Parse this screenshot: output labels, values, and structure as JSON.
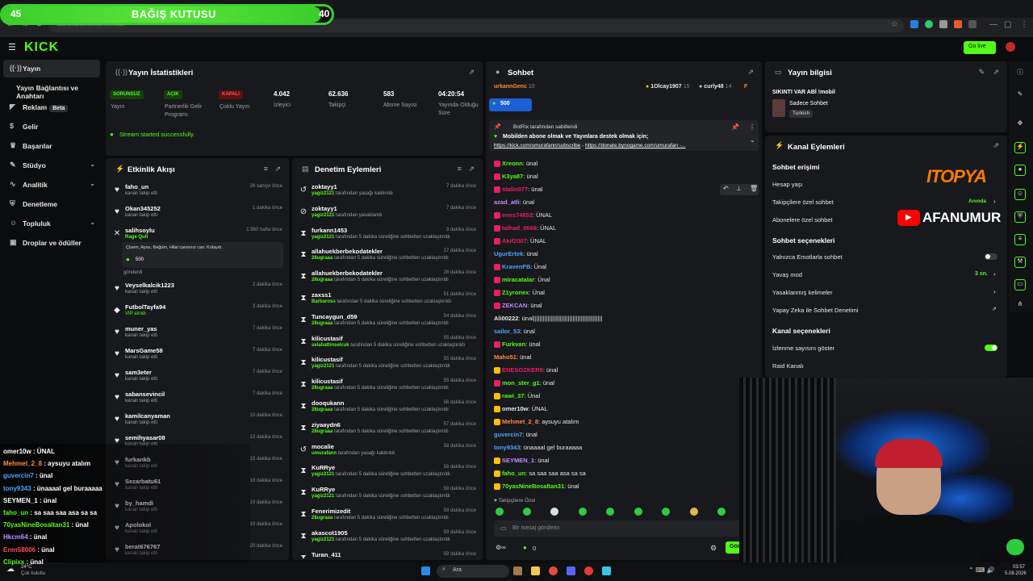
{
  "donation": {
    "title": "BAĞIŞ KUTUSU",
    "left_value": "45",
    "right_value": "40",
    "progress": 0.95
  },
  "browser": {
    "url": "dashboard.kick.com/stream"
  },
  "header": {
    "logo": "KICK",
    "go_live": "Go live"
  },
  "sidebar": {
    "items": [
      {
        "label": "Yayın",
        "icon": "broadcast-icon",
        "active": true
      },
      {
        "label": "Yayın Bağlantısı ve Anahtarı",
        "icon": "",
        "active": false
      },
      {
        "label": "Reklam",
        "badge": "Beta",
        "icon": "megaphone-icon"
      },
      {
        "label": "Gelir",
        "icon": "dollar-icon"
      },
      {
        "label": "Başarılar",
        "icon": "trophy-icon"
      },
      {
        "label": "Stüdyo",
        "icon": "brush-icon",
        "chevron": true
      },
      {
        "label": "Analitik",
        "icon": "chart-icon",
        "chevron": true
      },
      {
        "label": "Denetleme",
        "icon": "shield-icon"
      },
      {
        "label": "Topluluk",
        "icon": "users-icon",
        "chevron": true
      },
      {
        "label": "Droplar ve ödüller",
        "icon": "gift-icon"
      }
    ]
  },
  "stats": {
    "title": "Yayın İstatistikleri",
    "tags": [
      {
        "tag": "SORUNSUZ",
        "label": "Yayın",
        "color": "#53fc18"
      },
      {
        "tag": "AÇIK",
        "label": "Partnerlik Gelir Programı",
        "color": "#53fc18"
      },
      {
        "tag": "KAPALI",
        "label": "Çoklu Yayın",
        "color": "#e53935"
      }
    ],
    "values": [
      {
        "value": "4.042",
        "label": "İzleyici"
      },
      {
        "value": "62.636",
        "label": "Takipçi"
      },
      {
        "value": "583",
        "label": "Abone Sayısı"
      },
      {
        "value": "04:20:54",
        "label": "Yayında Olduğu Süre"
      }
    ],
    "status_message": "Stream started successfully."
  },
  "activity": {
    "title": "Etkinlik Akışı",
    "items": [
      {
        "name": "faho_un",
        "sub": "kanalı takip etti",
        "time": "26 saniye önce"
      },
      {
        "name": "Okan345252",
        "sub": "kanalı takip etti",
        "time": "1 dakika önce"
      },
      {
        "name": "salihsoylu",
        "sub": "Rage Quit",
        "time": "1.960 hafta önce",
        "message": "Çisem, Aysu, Beğüm, Hilal cansınız can. Kolaydı.",
        "amount": "500",
        "extra": "gönderdi"
      },
      {
        "name": "Veyselkalcik1223",
        "sub": "kanalı takip etti",
        "time": "2 dakika önce"
      },
      {
        "name": "FutbolTayfa94",
        "sub": "VIP alındı",
        "time": "3 dakika önce"
      },
      {
        "name": "muner_yas",
        "sub": "kanalı takip etti",
        "time": "7 dakika önce"
      },
      {
        "name": "MarsGame58",
        "sub": "kanalı takip etti",
        "time": "7 dakika önce"
      },
      {
        "name": "sam3eter",
        "sub": "kanalı takip etti",
        "time": "7 dakika önce"
      },
      {
        "name": "sabansevincil",
        "sub": "kanalı takip etti",
        "time": "7 dakika önce"
      },
      {
        "name": "kamilcanyaman",
        "sub": "kanalı takip etti",
        "time": "10 dakika önce"
      },
      {
        "name": "semihyasar08",
        "sub": "kanalı takip etti",
        "time": "13 dakika önce"
      },
      {
        "name": "furkankb",
        "sub": "kanalı takip etti",
        "time": "15 dakika önce"
      },
      {
        "name": "Sezarbatu61",
        "sub": "kanalı takip etti",
        "time": "18 dakika önce"
      },
      {
        "name": "by_hamdi",
        "sub": "kanalı takip etti",
        "time": "19 dakika önce"
      },
      {
        "name": "Apolokol",
        "sub": "kanalı takip etti",
        "time": "19 dakika önce"
      },
      {
        "name": "berat676767",
        "sub": "kanalı takip etti",
        "time": "20 dakika önce"
      }
    ]
  },
  "moderation": {
    "title": "Denetim Eylemleri",
    "items": [
      {
        "name": "zoktayy1",
        "mod": "yagiz2121",
        "action": "tarafından yasağı kaldırıldı",
        "time": "7 dakika önce",
        "type": "unban"
      },
      {
        "name": "zoktayy1",
        "mod": "yagiz2121",
        "action": "tarafından yasaklandı",
        "time": "7 dakika önce",
        "type": "ban"
      },
      {
        "name": "furkann1453",
        "mod": "yagiz2121",
        "action": "tarafından 5 dakika süreliğine sohbetten uzaklaştırıldı",
        "time": "9 dakika önce",
        "type": "timeout"
      },
      {
        "name": "allahuekberbekodatekler",
        "mod": "28ugraaa",
        "action": "tarafından 5 dakika süreliğine sohbetten uzaklaştırıldı",
        "time": "27 dakika önce",
        "type": "timeout"
      },
      {
        "name": "allahuekberbekodatekler",
        "mod": "28ugraaa",
        "action": "tarafından 5 dakika süreliğine sohbetten uzaklaştırıldı",
        "time": "28 dakika önce",
        "type": "timeout"
      },
      {
        "name": "zaxss1",
        "mod": "Barbaross",
        "action": "tarafından 5 dakika süreliğine sohbetten uzaklaştırıldı",
        "time": "51 dakika önce",
        "type": "timeout"
      },
      {
        "name": "Tuncaygun_d59",
        "mod": "28ugraaa",
        "action": "tarafından 5 dakika süreliğine sohbetten uzaklaştırıldı",
        "time": "54 dakika önce",
        "type": "timeout"
      },
      {
        "name": "kilicustasif",
        "mod": "selahattinselcuk",
        "action": "tarafından 5 dakika süreliğine sohbetten uzaklaştırıldı",
        "time": "55 dakika önce",
        "type": "timeout"
      },
      {
        "name": "kilicustasif",
        "mod": "yagiz2121",
        "action": "tarafından 5 dakika süreliğine sohbetten uzaklaştırıldı",
        "time": "55 dakika önce",
        "type": "timeout"
      },
      {
        "name": "kilicustasif",
        "mod": "28ugraaa",
        "action": "tarafından 5 dakika süreliğine sohbetten uzaklaştırıldı",
        "time": "55 dakika önce",
        "type": "timeout"
      },
      {
        "name": "dooqukann",
        "mod": "28ugraaa",
        "action": "tarafından 5 dakika süreliğine sohbetten uzaklaştırıldı",
        "time": "56 dakika önce",
        "type": "timeout"
      },
      {
        "name": "ziyaaydn6",
        "mod": "28ugraaa",
        "action": "tarafından 5 dakika süreliğine sohbetten uzaklaştırıldı",
        "time": "57 dakika önce",
        "type": "timeout"
      },
      {
        "name": "mocalie",
        "mod": "umurafann",
        "action": "tarafından yasağı kaldırıldı",
        "time": "58 dakika önce",
        "type": "unban"
      },
      {
        "name": "KuRRye",
        "mod": "yagiz2121",
        "action": "tarafından 5 dakika süreliğine sohbetten uzaklaştırıldı",
        "time": "58 dakika önce",
        "type": "timeout"
      },
      {
        "name": "KuRRye",
        "mod": "yagiz2121",
        "action": "tarafından 5 dakika süreliğine sohbetten uzaklaştırıldı",
        "time": "58 dakika önce",
        "type": "timeout"
      },
      {
        "name": "Fenerimizedit",
        "mod": "28ugraaa",
        "action": "tarafından 5 dakika süreliğine sohbetten uzaklaştırıldı",
        "time": "59 dakika önce",
        "type": "timeout"
      },
      {
        "name": "akascot1905",
        "mod": "yagiz2121",
        "action": "tarafından 5 dakika süreliğine sohbetten uzaklaştırıldı",
        "time": "59 dakika önce",
        "type": "timeout"
      },
      {
        "name": "Turan_411",
        "mod": "",
        "action": "",
        "time": "59 dakika önce",
        "type": "timeout"
      }
    ]
  },
  "chat": {
    "title": "Sohbet",
    "top_gifters": [
      {
        "name": "urkannGenc",
        "count": "10"
      },
      {
        "name": "1Olcay1907",
        "count": "15"
      },
      {
        "name": "curly48",
        "count": "14"
      },
      {
        "name": "F",
        "count": ""
      }
    ],
    "goal_amount": "500",
    "pinned": {
      "by": "BotRix tarafından sabitlendi",
      "text": "Mobilden abone olmak ve Yayınlara destek olmak için;",
      "link1": "https://kick.com/umurafann/subscribe",
      "sep": " - ",
      "link2": "https://donate.bynogame.com/umurafan -..."
    },
    "messages": [
      {
        "user": "Xreonn",
        "text": "ünal",
        "color": "#53fc18",
        "badge": "#e91e63"
      },
      {
        "user": "K3ya87",
        "text": "ünal",
        "color": "#53fc18",
        "badge": "#e91e63"
      },
      {
        "user": "stalin077",
        "text": "ünal",
        "color": "#e91e63",
        "badge": "#e91e63"
      },
      {
        "user": "azad_atli",
        "text": "ünal",
        "color": "#c08bff",
        "badge": ""
      },
      {
        "user": "enes74853",
        "text": "ÜNAL",
        "color": "#e91e63",
        "badge": "#e91e63"
      },
      {
        "user": "talhad_0668",
        "text": "ÜNAL",
        "color": "#e91e63",
        "badge": "#e91e63"
      },
      {
        "user": "Akif2007",
        "text": "ÜNAL",
        "color": "#e91e63",
        "badge": "#e91e63"
      },
      {
        "user": "UgurErtek",
        "text": "ünal",
        "color": "#4ea3ff",
        "badge": ""
      },
      {
        "user": "KravenFB",
        "text": "Ünal",
        "color": "#4ea3ff",
        "badge": "#e91e63"
      },
      {
        "user": "miracatalar",
        "text": "Ünal",
        "color": "#53fc18",
        "badge": "#e91e63"
      },
      {
        "user": "Z1yronex",
        "text": "Ünal",
        "color": "#53fc18",
        "badge": "#e91e63"
      },
      {
        "user": "ZEKCAN",
        "text": "ünal",
        "color": "#c08bff",
        "badge": "#e91e63"
      },
      {
        "user": "Ali00222",
        "text": "ünal||||||||||||||||||||||||||||||||||||||||||||",
        "color": "#e7e8ea",
        "badge": ""
      },
      {
        "user": "sailor_53",
        "text": "ünal",
        "color": "#4ea3ff",
        "badge": ""
      },
      {
        "user": "Furkvan",
        "text": "ünal",
        "color": "#53fc18",
        "badge": "#e91e63"
      },
      {
        "user": "Maho51",
        "text": "ünal",
        "color": "#ff8a3d",
        "badge": ""
      },
      {
        "user": "ENESOZKER9",
        "text": "ünal",
        "color": "#e91e63",
        "badge": "#ffc107"
      },
      {
        "user": "mon_ster_g1",
        "text": "ünal",
        "color": "#53fc18",
        "badge": "#e91e63"
      },
      {
        "user": "rawi_37",
        "text": "Ünal",
        "color": "#53fc18",
        "badge": "#ffc107"
      },
      {
        "user": "omer10w",
        "text": "ÜNAL",
        "color": "#e7e8ea",
        "badge": "#ffc107"
      },
      {
        "user": "Mehmet_2_8",
        "text": "aysuyu atalım",
        "color": "#ff8a3d",
        "badge": "#ffc107"
      },
      {
        "user": "guvercin7",
        "text": "ünal",
        "color": "#4ea3ff",
        "badge": ""
      },
      {
        "user": "tony9343",
        "text": "ünaaaal gel buraaaaa",
        "color": "#4ea3ff",
        "badge": ""
      },
      {
        "user": "SEYMEN_1",
        "text": "ünal",
        "color": "#c08bff",
        "badge": "#ffc107"
      },
      {
        "user": "faho_un",
        "text": "sa saa saa asa sa sa",
        "color": "#53fc18",
        "badge": "#ffc107"
      },
      {
        "user": "70yasNineBosaltan31",
        "text": "ünal",
        "color": "#53fc18",
        "badge": "#ffc107"
      }
    ],
    "follower_only": "Takipçilere Özel",
    "input_placeholder": "Bir mesaj gönderin",
    "points": "0",
    "send_label": "Gönder"
  },
  "stream_info": {
    "title": "Yayın bilgisi",
    "stream_title": "SIKINTI VAR ABİ !mobil",
    "mode": "Sadece Sohbet",
    "category": "Turkish"
  },
  "channel_actions": {
    "title": "Kanal Eylemleri",
    "chat_access": "Sohbet erişimi",
    "account_age": "Hesap yaşı",
    "followers_only": "Takipçilere özel sohbet",
    "followers_only_value": "Anında",
    "subs_only": "Abonelere özel sohbet",
    "chat_options": "Sohbet seçenekleri",
    "emotes_only": "Yalnızca Emotlarla sohbet",
    "emotes_only_on": false,
    "slow_mode": "Yavaş mod",
    "slow_mode_value": "3 sn.",
    "banned_words": "Yasaklanmış kelimeler",
    "ai_moderation": "Yapay Zeka ile Sohbet Denetimi",
    "channel_options": "Kanal seçenekleri",
    "show_viewers": "İzlenme sayısını göster",
    "show_viewers_on": true,
    "raid": "Raid Kanalı"
  },
  "overlay": {
    "brand1": "ITOPYA",
    "brand2": "AFANUMUR"
  },
  "overlay_chat": [
    {
      "user": "omer10w",
      "text": "ÜNAL",
      "color": "#ffffff"
    },
    {
      "user": "Mehmet_2_8",
      "text": "aysuyu atalım",
      "color": "#ff8a3d"
    },
    {
      "user": "guvercin7",
      "text": "ünal",
      "color": "#4ea3ff"
    },
    {
      "user": "tony9343",
      "text": "ünaaaal gel buraaaaa",
      "color": "#4ea3ff"
    },
    {
      "user": "SEYMEN_1",
      "text": "ünal",
      "color": "#ffffff"
    },
    {
      "user": "faho_un",
      "text": "sa saa saa asa sa sa",
      "color": "#53fc18"
    },
    {
      "user": "70yasNineBosaltan31",
      "text": "ünal",
      "color": "#53fc18"
    },
    {
      "user": "Hkcm64",
      "text": "ünal",
      "color": "#c08bff"
    },
    {
      "user": "Eren58006",
      "text": "ünal",
      "color": "#ff4d4d"
    },
    {
      "user": "Clipixx",
      "text": "ünal",
      "color": "#53fc18"
    }
  ],
  "taskbar": {
    "weather_temp": "24°C",
    "weather_desc": "Çok bulutlu",
    "search": "Ara",
    "time": "03:57",
    "date": "5.08.2026"
  }
}
